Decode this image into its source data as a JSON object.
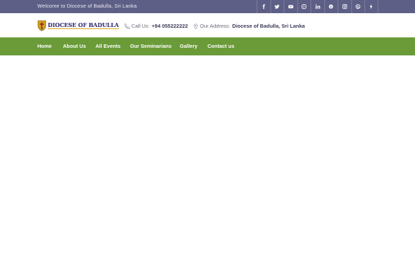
{
  "topbar": {
    "welcome": "Welcome to Diocese of Badulla, Sri Lanka",
    "social": [
      {
        "icon": "facebook-icon"
      },
      {
        "icon": "twitter-icon"
      },
      {
        "icon": "youtube-icon"
      },
      {
        "icon": "pinterest-icon"
      },
      {
        "icon": "linkedin-icon"
      },
      {
        "icon": "skype-icon"
      },
      {
        "icon": "instagram-icon"
      },
      {
        "icon": "dribbble-icon"
      },
      {
        "icon": "flash-icon"
      }
    ]
  },
  "header": {
    "logo_text": "DIOCESE OF BADULLA",
    "call_label": "Call Us:",
    "call_value": "+94 055222222",
    "address_label": "Our Address:",
    "address_value": "Diocese of Badulla, Sri Lanka"
  },
  "nav": {
    "items": [
      {
        "label": "Home"
      },
      {
        "label": "About Us"
      },
      {
        "label": "All Events"
      },
      {
        "label": "Our Seminarians"
      },
      {
        "label": "Gallery"
      },
      {
        "label": "Contact us"
      }
    ]
  },
  "colors": {
    "topbar": "#5e5f86",
    "nav": "#6a9b38"
  }
}
